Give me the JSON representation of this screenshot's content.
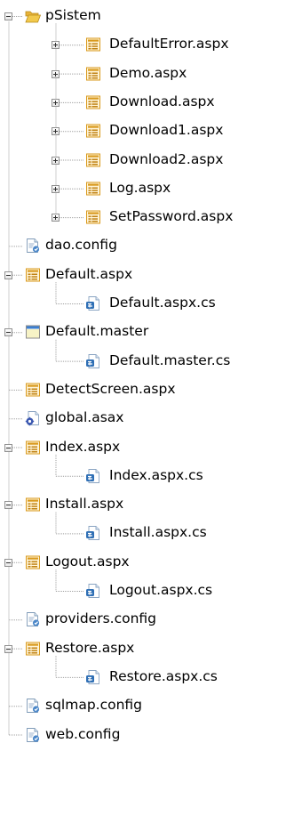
{
  "tree": {
    "nodes": [
      {
        "label": "pSistem",
        "depth": 0,
        "toggle": "minus",
        "icon": "folder-open-icon",
        "line_to_next": true
      },
      {
        "label": "DefaultError.aspx",
        "depth": 1,
        "toggle": "plus",
        "icon": "aspx-page-icon"
      },
      {
        "label": "Demo.aspx",
        "depth": 1,
        "toggle": "plus",
        "icon": "aspx-page-icon"
      },
      {
        "label": "Download.aspx",
        "depth": 1,
        "toggle": "plus",
        "icon": "aspx-page-icon"
      },
      {
        "label": "Download1.aspx",
        "depth": 1,
        "toggle": "plus",
        "icon": "aspx-page-icon"
      },
      {
        "label": "Download2.aspx",
        "depth": 1,
        "toggle": "plus",
        "icon": "aspx-page-icon"
      },
      {
        "label": "Log.aspx",
        "depth": 1,
        "toggle": "plus",
        "icon": "aspx-page-icon"
      },
      {
        "label": "SetPassword.aspx",
        "depth": 1,
        "toggle": "plus",
        "icon": "aspx-page-icon"
      },
      {
        "label": "dao.config",
        "depth": 0,
        "toggle": "none",
        "icon": "config-file-icon"
      },
      {
        "label": "Default.aspx",
        "depth": 0,
        "toggle": "minus",
        "icon": "aspx-page-icon"
      },
      {
        "label": "Default.aspx.cs",
        "depth": 1,
        "toggle": "none",
        "icon": "csharp-file-icon",
        "last_child": true
      },
      {
        "label": "Default.master",
        "depth": 0,
        "toggle": "minus",
        "icon": "master-page-icon"
      },
      {
        "label": "Default.master.cs",
        "depth": 1,
        "toggle": "none",
        "icon": "csharp-file-icon",
        "last_child": true
      },
      {
        "label": "DetectScreen.aspx",
        "depth": 0,
        "toggle": "none",
        "icon": "aspx-page-icon"
      },
      {
        "label": "global.asax",
        "depth": 0,
        "toggle": "none",
        "icon": "global-asax-icon"
      },
      {
        "label": "Index.aspx",
        "depth": 0,
        "toggle": "minus",
        "icon": "aspx-page-icon"
      },
      {
        "label": "Index.aspx.cs",
        "depth": 1,
        "toggle": "none",
        "icon": "csharp-file-icon",
        "last_child": true
      },
      {
        "label": "Install.aspx",
        "depth": 0,
        "toggle": "minus",
        "icon": "aspx-page-icon"
      },
      {
        "label": "Install.aspx.cs",
        "depth": 1,
        "toggle": "none",
        "icon": "csharp-file-icon",
        "last_child": true
      },
      {
        "label": "Logout.aspx",
        "depth": 0,
        "toggle": "minus",
        "icon": "aspx-page-icon"
      },
      {
        "label": "Logout.aspx.cs",
        "depth": 1,
        "toggle": "none",
        "icon": "csharp-file-icon",
        "last_child": true
      },
      {
        "label": "providers.config",
        "depth": 0,
        "toggle": "none",
        "icon": "config-file-icon"
      },
      {
        "label": "Restore.aspx",
        "depth": 0,
        "toggle": "minus",
        "icon": "aspx-page-icon"
      },
      {
        "label": "Restore.aspx.cs",
        "depth": 1,
        "toggle": "none",
        "icon": "csharp-file-icon",
        "last_child": true
      },
      {
        "label": "sqlmap.config",
        "depth": 0,
        "toggle": "none",
        "icon": "config-file-icon"
      },
      {
        "label": "web.config",
        "depth": 0,
        "toggle": "none",
        "icon": "config-file-icon",
        "last_child": true
      }
    ]
  },
  "colors": {
    "tree_line": "#a0a0a0",
    "folder": "#f2c94c",
    "aspx_icon": "#d99a1e",
    "cs_icon": "#2f6fb5",
    "config_icon": "#4a86c8",
    "master_title": "#3c7fd1"
  }
}
